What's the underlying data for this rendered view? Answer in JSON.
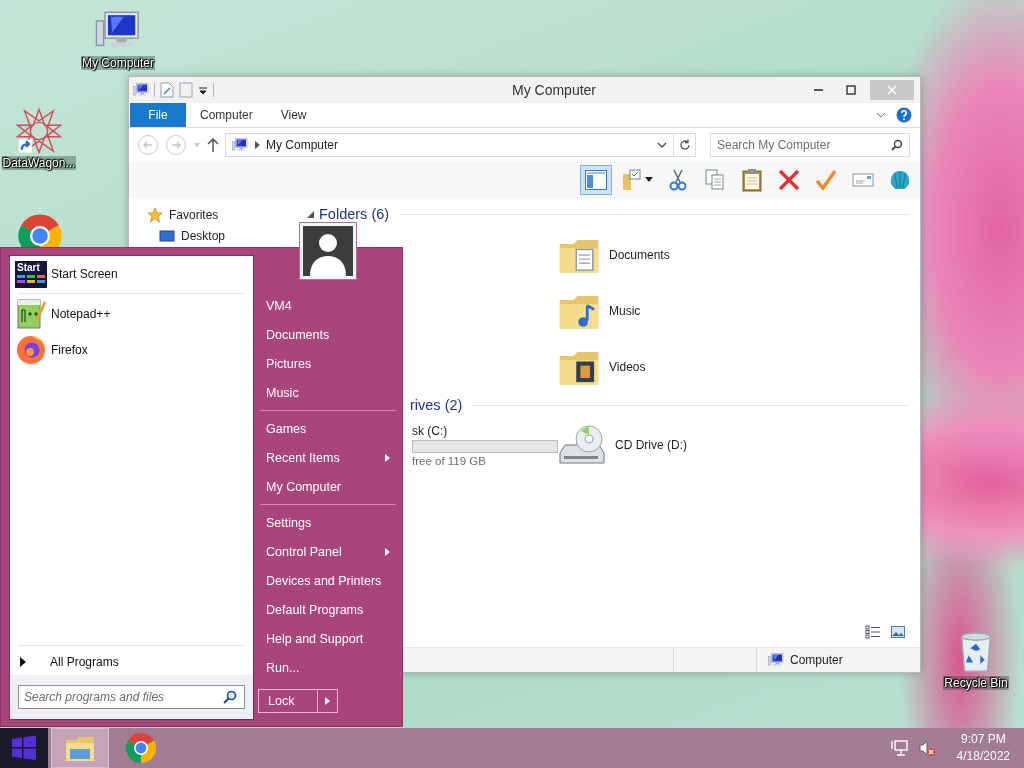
{
  "desktop_icons": [
    {
      "kind": "computer",
      "label": "My Computer"
    },
    {
      "kind": "datawagon",
      "label": "DataWagon..."
    },
    {
      "kind": "chrome"
    },
    {
      "kind": "recycle",
      "label": "Recycle Bin"
    }
  ],
  "window": {
    "title": "My Computer",
    "file_tab": "File",
    "ribbon_tabs": [
      "Computer",
      "View"
    ],
    "address": "My Computer",
    "search": {
      "placeholder": "Search My Computer"
    },
    "preview_pane": {
      "on": true
    },
    "toolbar": [
      {
        "kind": "select"
      },
      {
        "kind": "cut"
      },
      {
        "kind": "copy"
      },
      {
        "kind": "paste"
      },
      {
        "kind": "delete"
      },
      {
        "kind": "check"
      },
      {
        "kind": "rename"
      },
      {
        "kind": "shell"
      }
    ],
    "navigation": [
      {
        "kind": "favorites",
        "label": "Favorites"
      },
      {
        "kind": "desktop",
        "label": "Desktop"
      }
    ],
    "folders": {
      "header": "Folders (6)",
      "items": [
        {
          "kind": "documents",
          "label": "Documents"
        },
        {
          "kind": "music",
          "label": "Music"
        },
        {
          "kind": "videos",
          "label": "Videos"
        }
      ]
    },
    "drives": {
      "header": "rives (2)",
      "items": [
        {
          "kind": "hdd",
          "label": "sk (C:)",
          "space": "free of 119 GB"
        },
        {
          "kind": "cd",
          "label": "CD Drive (D:)"
        }
      ]
    },
    "status_bar": {
      "location": "Computer"
    }
  },
  "start_menu": {
    "pinned": [
      {
        "kind": "start-screen",
        "label": "Start Screen",
        "icon_text": "Start"
      }
    ],
    "recent": [
      {
        "kind": "notepad",
        "label": "Notepad++"
      },
      {
        "kind": "firefox",
        "label": "Firefox"
      }
    ],
    "all_programs": "All Programs",
    "search": {
      "placeholder": "Search programs and files"
    },
    "groups": [
      {
        "items": [
          {
            "label": "VM4",
            "submenu": false
          },
          {
            "label": "Documents",
            "submenu": false
          },
          {
            "label": "Pictures",
            "submenu": false
          },
          {
            "label": "Music",
            "submenu": false
          }
        ]
      },
      {
        "items": [
          {
            "label": "Games",
            "submenu": false
          },
          {
            "label": "Recent Items",
            "submenu": true
          },
          {
            "label": "My Computer",
            "submenu": false
          }
        ]
      },
      {
        "items": [
          {
            "label": "Settings",
            "submenu": false
          },
          {
            "label": "Control Panel",
            "submenu": true
          },
          {
            "label": "Devices and Printers",
            "submenu": false
          },
          {
            "label": "Default Programs",
            "submenu": false
          },
          {
            "label": "Help and Support",
            "submenu": false
          },
          {
            "label": "Run...",
            "submenu": false
          }
        ]
      }
    ],
    "lock": "Lock"
  },
  "taskbar": {
    "apps": [
      {
        "kind": "explorer",
        "selected": true
      },
      {
        "kind": "chrome",
        "selected": false
      }
    ],
    "volume_muted": true,
    "time": "9:07 PM",
    "date": "4/18/2022"
  }
}
